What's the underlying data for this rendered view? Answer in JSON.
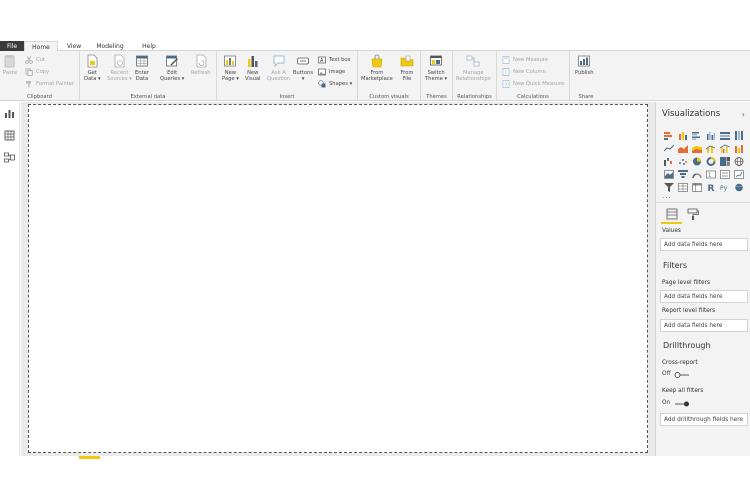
{
  "menu": {
    "tabs": [
      "File",
      "Home",
      "View",
      "Modeling",
      "Help"
    ]
  },
  "ribbon": {
    "groups": {
      "clipboard": "Clipboard",
      "external_data": "External data",
      "insert": "Insert",
      "custom_visuals": "Custom visuals",
      "themes": "Themes",
      "relationships": "Relationships",
      "calculations": "Calculations",
      "share": "Share"
    },
    "buttons": {
      "paste": "Paste",
      "cut": "Cut",
      "copy": "Copy",
      "format_painter": "Format Painter",
      "get_data_1": "Get",
      "get_data_2": "Data ▾",
      "recent_sources_1": "Recent",
      "recent_sources_2": "Sources ▾",
      "enter_data_1": "Enter",
      "enter_data_2": "Data",
      "edit_queries_1": "Edit",
      "edit_queries_2": "Queries ▾",
      "refresh": "Refresh",
      "new_page_1": "New",
      "new_page_2": "Page ▾",
      "new_visual_1": "New",
      "new_visual_2": "Visual",
      "ask_question_1": "Ask A",
      "ask_question_2": "Question",
      "buttons_1": "Buttons",
      "buttons_2": "▾",
      "text_box": "Text box",
      "image": "Image",
      "shapes": "Shapes ▾",
      "from_marketplace_1": "From",
      "from_marketplace_2": "Marketplace",
      "from_file_1": "From",
      "from_file_2": "File",
      "switch_theme_1": "Switch",
      "switch_theme_2": "Theme ▾",
      "manage_relationships_1": "Manage",
      "manage_relationships_2": "Relationships",
      "new_measure": "New Measure",
      "new_column": "New Column",
      "new_quick_measure": "New Quick Measure",
      "publish": "Publish"
    }
  },
  "pane": {
    "title": "Visualizations",
    "more": "...",
    "values_label": "Values",
    "values_drop": "Add data fields here",
    "filters_heading": "Filters",
    "page_filters_label": "Page level filters",
    "page_filters_drop": "Add data fields here",
    "report_filters_label": "Report level filters",
    "report_filters_drop": "Add data fields here",
    "drillthrough_heading": "Drillthrough",
    "cross_report_label": "Cross-report",
    "cross_report_state": "Off",
    "keep_filters_label": "Keep all filters",
    "keep_filters_state": "On",
    "drillthrough_drop": "Add drillthrough fields here"
  },
  "colors": {
    "accent": "#f2c80f",
    "file_tab": "#3b3b3b",
    "ribbon_bg": "#f3f3f3"
  }
}
